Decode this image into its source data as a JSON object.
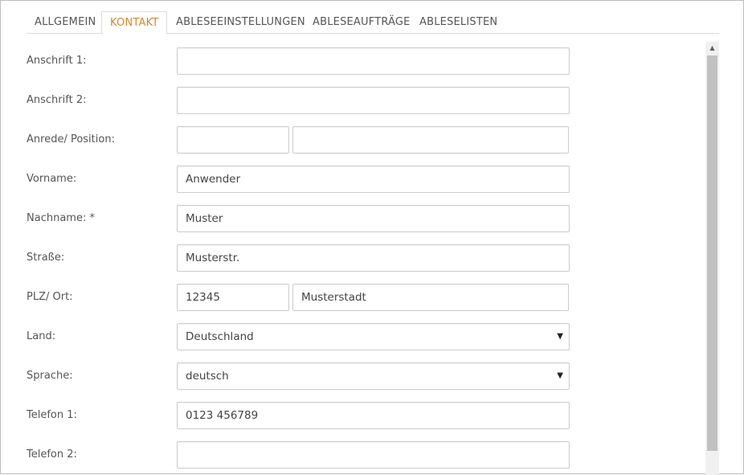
{
  "tabs": [
    {
      "label": "ALLGEMEIN",
      "active": false
    },
    {
      "label": "KONTAKT",
      "active": true
    },
    {
      "label": "ABLESEEINSTELLUNGEN",
      "active": false
    },
    {
      "label": "ABLESEAUFTRÄGE",
      "active": false
    },
    {
      "label": "ABLESELISTEN",
      "active": false
    }
  ],
  "form": {
    "anschrift1": {
      "label": "Anschrift 1:",
      "value": ""
    },
    "anschrift2": {
      "label": "Anschrift 2:",
      "value": ""
    },
    "anrede_position": {
      "label": "Anrede/ Position:",
      "anrede": "",
      "position": ""
    },
    "vorname": {
      "label": "Vorname:",
      "value": "Anwender"
    },
    "nachname": {
      "label": "Nachname: *",
      "value": "Muster"
    },
    "strasse": {
      "label": "Straße:",
      "value": "Musterstr."
    },
    "plz_ort": {
      "label": "PLZ/ Ort:",
      "plz": "12345",
      "ort": "Musterstadt"
    },
    "land": {
      "label": "Land:",
      "value": "Deutschland"
    },
    "sprache": {
      "label": "Sprache:",
      "value": "deutsch"
    },
    "telefon1": {
      "label": "Telefon 1:",
      "value": "0123 456789"
    },
    "telefon2": {
      "label": "Telefon 2:",
      "value": ""
    }
  },
  "icons": {
    "select_caret": "▼",
    "scroll_up": "▲"
  },
  "colors": {
    "active_tab": "#d6892a",
    "border": "#cccccc"
  }
}
